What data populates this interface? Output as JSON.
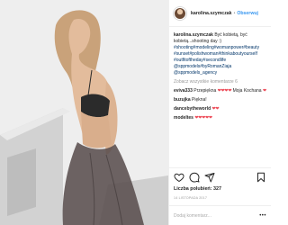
{
  "header": {
    "username": "karolina.szymczak",
    "separator": "•",
    "follow_label": "Obserwuj"
  },
  "caption": {
    "username": "karolina.szymczak",
    "text": "Być kobietą, być kobietą...shooting day :)",
    "hashtags": "#shooting#modeling#womanpower#beauty #sunset#polishwoman#thinkaboutyourself #outfitoftheday#secondlife",
    "mentions": "@sppmodels#byRomanZiaja @sppmodels_agency"
  },
  "view_all_comments": "Zobacz wszystkie komentarze 6",
  "comments": [
    {
      "username": "eviva333",
      "text": "Przepiękna",
      "hearts": "❤❤❤❤",
      "extra": "Moja Kochana",
      "extra_hearts": "❤"
    },
    {
      "username": "buzujka",
      "text": "Piękna!",
      "hearts": "",
      "extra": "",
      "extra_hearts": ""
    },
    {
      "username": "dancebytheworld",
      "text": "",
      "hearts": "❤❤",
      "extra": "",
      "extra_hearts": ""
    },
    {
      "username": "modeltes",
      "text": "",
      "hearts": "❤❤❤❤❤",
      "extra": "",
      "extra_hearts": ""
    }
  ],
  "icons": [
    "heart-icon",
    "comment-icon",
    "share-icon",
    "bookmark-icon",
    "more-icon"
  ],
  "likes_label": "Liczba polubień: 327",
  "date": "14 LISTOPADA 2017",
  "add_comment": {
    "placeholder": "Dodaj komentarz...",
    "more_glyph": "•••"
  },
  "colors": {
    "link": "#3897f0",
    "hashtag": "#003569",
    "heart": "#ed4956",
    "muted": "#999999"
  }
}
